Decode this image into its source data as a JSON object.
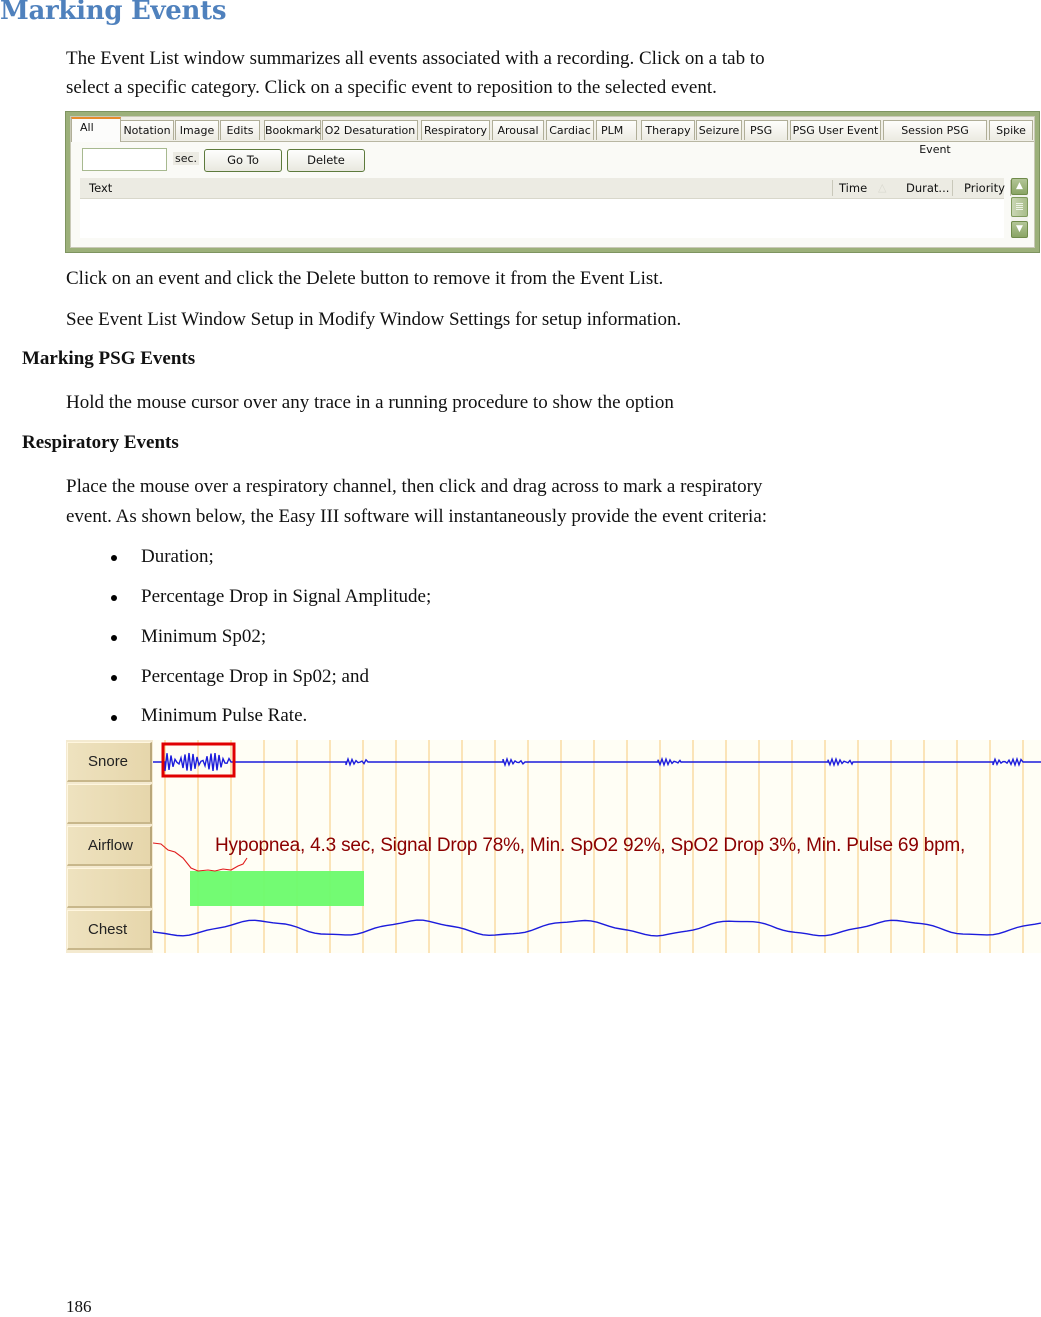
{
  "heading": "Marking Events",
  "intro": [
    "The Event List window summarizes all events associated with a recording.  Click on a tab to",
    "select a specific category.  Click on a specific event to reposition to the selected event."
  ],
  "event_list": {
    "tabs": [
      {
        "label": "All",
        "active": true
      },
      {
        "label": "Notation"
      },
      {
        "label": "Image"
      },
      {
        "label": "Edits"
      },
      {
        "label": "Bookmark"
      },
      {
        "label": "O2 Desaturation"
      },
      {
        "label": "Respiratory"
      },
      {
        "label": "Arousal"
      },
      {
        "label": "Cardiac"
      },
      {
        "label": "PLM"
      },
      {
        "label": "Therapy"
      },
      {
        "label": "Seizure"
      },
      {
        "label": "PSG"
      },
      {
        "label": "PSG User Event"
      },
      {
        "label": "Session PSG Event"
      },
      {
        "label": "Spike"
      }
    ],
    "seconds_value": "",
    "seconds_unit": "sec.",
    "goto_label": "Go To",
    "delete_label": "Delete",
    "columns": [
      "Text",
      "Time",
      "Durat...",
      "Priority"
    ],
    "sort_indicator": "△",
    "rows": []
  },
  "para_delete": "Click on an event and click the Delete button to remove it from the Event List.",
  "para_see": "See Event List Window Setup in Modify Window Settings for setup information.",
  "section_psg": {
    "title": "Marking PSG Events",
    "text": "Hold the mouse cursor over any trace in a running procedure to show the option"
  },
  "section_resp": {
    "title": "Respiratory Events",
    "text": [
      "Place the mouse over a respiratory channel, then click and drag across to mark a respiratory",
      "event. As shown below, the Easy III software will instantaneously provide the event criteria:"
    ],
    "criteria": [
      "Duration;",
      "Percentage Drop in Signal Amplitude;",
      "Minimum Sp02;",
      "Percentage Drop in Sp02; and",
      "Minimum Pulse Rate."
    ]
  },
  "psg_view": {
    "channels": [
      "Snore",
      "",
      "Airflow",
      "",
      "Chest"
    ],
    "event_annotation": "Hypopnea, 4.3 sec, Signal Drop 78%, Min. SpO2 92%, SpO2 Drop 3%, Min. Pulse 69 bpm,",
    "colors": {
      "trace_blue": "#1c1cdc",
      "trace_red": "#e01c1c",
      "highlight_box": "#e00000",
      "event_bar": "#6cfb6c",
      "gridline": "#f7c97a",
      "annotation_text": "#8b0000"
    }
  },
  "page_number": "186"
}
